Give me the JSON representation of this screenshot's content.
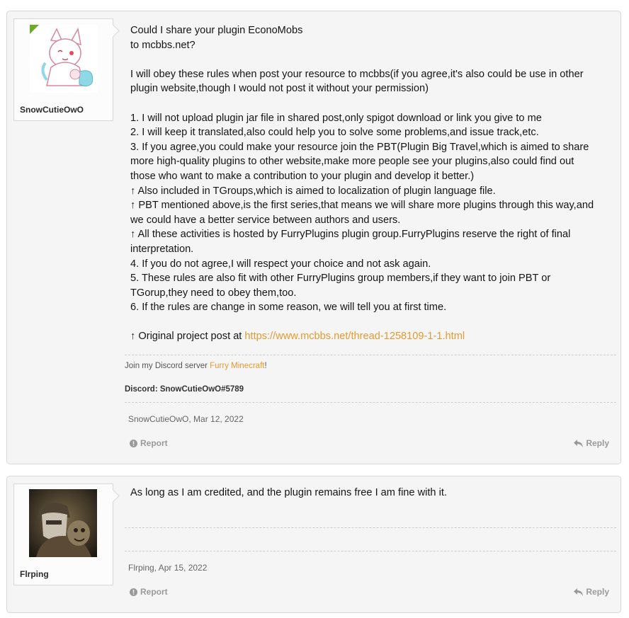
{
  "posts": [
    {
      "author": "SnowCutieOwO",
      "message_lines": [
        "Could I share your plugin EconoMobs",
        "to mcbbs.net?",
        "",
        "I will obey these rules when post your resource to mcbbs(if you agree,it's also could be use in other",
        "plugin website,though I would not post it without your permission)",
        "",
        "1. I will not upload plugin jar file in shared post,only spigot download or link you give to me",
        "2. I will keep it translated,also could help you to solve some problems,and issue track,etc.",
        "3. If you agree,you could make your resource join the PBT(Plugin Big Travel,which is aimed to share",
        "more high-quality plugins to other website,make more people see your plugins,also could find out",
        "those who want to make a contribution to your plugin and develop it better.)",
        "↑ Also included in TGroups,which is aimed to localization of plugin language file.",
        "↑ PBT mentioned above,is the first series,that means we will share more plugins through this way,and",
        "we could have a better service between authors and users.",
        "↑ All these activities is hosted by FurryPlugins plugin group.FurryPlugins reserve the right of final",
        "interpretation.",
        "4. If you do not agree,I will respect your choice and not ask again.",
        "5. These rules are also fit with other FurryPlugins group members,if they want to join PBT or",
        "TGorup,they need to obey them,too.",
        "6. If the rules are change in some reason, we will tell you at first time.",
        ""
      ],
      "original_post_prefix": "↑ Original project post at ",
      "original_post_link": "https://www.mcbbs.net/thread-1258109-1-1.html",
      "signature": {
        "discord_prefix": "Join my Discord server ",
        "discord_link": "Furry Minecraft",
        "discord_suffix": "!",
        "discord_tag": "Discord: SnowCutieOwO#5789"
      },
      "byline": "SnowCutieOwO, Mar 12, 2022",
      "report_label": "Report",
      "reply_label": "Reply"
    },
    {
      "author": "Flrping",
      "message": "As long as I am credited, and the plugin remains free I am fine with it.",
      "byline": "Flrping, Apr 15, 2022",
      "report_label": "Report",
      "reply_label": "Reply"
    }
  ],
  "icons": {
    "report": "warning-circle-icon",
    "reply": "reply-arrow-icon",
    "online": "online-indicator-icon"
  },
  "colors": {
    "link": "#e59a2e",
    "online": "#6bac27",
    "action": "#9a9a9a"
  }
}
